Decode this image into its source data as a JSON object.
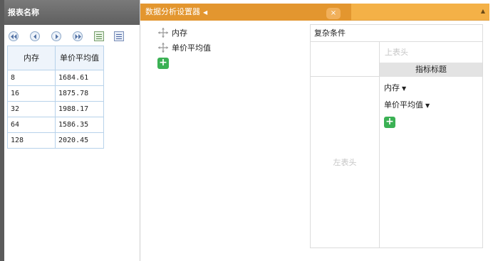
{
  "report_panel": {
    "title": "报表名称",
    "table": {
      "headers": [
        "内存",
        "单价平均值"
      ],
      "rows": [
        [
          "8",
          "1684.61"
        ],
        [
          "16",
          "1875.78"
        ],
        [
          "32",
          "1988.17"
        ],
        [
          "64",
          "1586.35"
        ],
        [
          "128",
          "2020.45"
        ]
      ]
    },
    "pager_icons": [
      "first-page-icon",
      "prev-page-icon",
      "next-page-icon",
      "last-page-icon",
      "export-excel-icon",
      "export-doc-icon"
    ]
  },
  "settings_panel": {
    "tab_title": "数据分析设置器",
    "tab_arrow": "◀",
    "tab_close": "×",
    "collapse_glyph": "▲",
    "fields": [
      "内存",
      "单价平均值"
    ],
    "add_label": "+",
    "pivot": {
      "title": "复杂条件",
      "top_header_placeholder": "上表头",
      "metric_header": "指标标题",
      "left_header_placeholder": "左表头",
      "items": [
        {
          "label": "内存",
          "arrow": "▼"
        },
        {
          "label": "单价平均值",
          "arrow": "▼"
        }
      ]
    }
  },
  "colors": {
    "tab_active": "#e3962f",
    "tab_bar": "#f4b147",
    "add_green": "#3bb154",
    "header_gray": "#5f5f5f",
    "table_border": "#b7d2ea"
  }
}
